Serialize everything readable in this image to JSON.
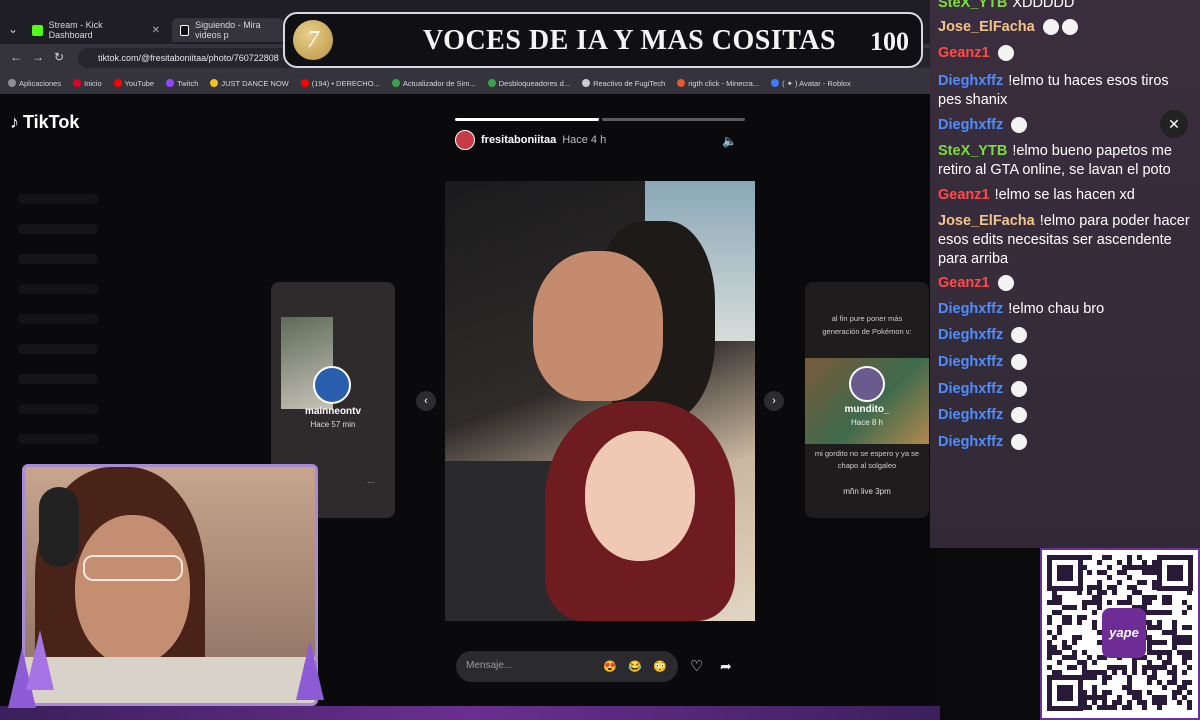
{
  "browser": {
    "tabs": [
      {
        "label": "Stream - Kick Dashboard",
        "icon": "kick-icon",
        "color": "#53fc18"
      },
      {
        "label": "Siguiendo - Mira videos p",
        "icon": "tiktok-icon",
        "color": "#ffffff"
      }
    ],
    "url": "tiktok.com/@fresitaboniitaa/photo/760722808",
    "bookmarks": [
      {
        "label": "Aplicaciones",
        "color": "#8f8f96"
      },
      {
        "label": "Inicio",
        "color": "#e60023"
      },
      {
        "label": "YouTube",
        "color": "#ff0000"
      },
      {
        "label": "Twitch",
        "color": "#9146ff"
      },
      {
        "label": "JUST DANCE NOW",
        "color": "#f0c020"
      },
      {
        "label": "(194) • DERECHO...",
        "color": "#ff0000"
      },
      {
        "label": "Actualizador de Sim...",
        "color": "#3ca34a"
      },
      {
        "label": "Desbloqueadores d...",
        "color": "#3ca34a"
      },
      {
        "label": "Reactivo de FugiTech",
        "color": "#cccccc"
      },
      {
        "label": "rigth click - Minecra...",
        "color": "#e05a2b"
      },
      {
        "label": "( ✦ ) Avatar - Roblox",
        "color": "#3d7bff"
      }
    ]
  },
  "overlay": {
    "number": "7",
    "title": "VOCES DE IA Y MAS COSITAS",
    "count": "100"
  },
  "tiktok": {
    "logo": "TikTok",
    "author": "fresitaboniitaa",
    "time": "Hace 4 h",
    "message_placeholder": "Mensaje...",
    "emojis": [
      "😍",
      "😂",
      "😳"
    ],
    "left_card": {
      "name": "mainneontv",
      "time": "Hace 57 min",
      "more": "..."
    },
    "right_card": {
      "caption_top": "al fin pure poner más generación de Pokémon v:",
      "name": "mundito_",
      "time": "Hace 8 h",
      "caption_bottom": "mi gordito no se espero y ya se chapo al solgaleo",
      "live": "mñn live 3pm"
    }
  },
  "chat": {
    "messages": [
      {
        "user": "SteX_YTB",
        "color": "#7ddc3f",
        "text": "XDDDDD",
        "emotes": 0
      },
      {
        "user": "Jose_ElFacha",
        "color": "#f2c48a",
        "text": "",
        "emotes": 2
      },
      {
        "user": "Geanz1",
        "color": "#ff4a4a",
        "text": "",
        "emotes": 1
      },
      {
        "user": "Dieghxffz",
        "color": "#4f8dff",
        "text": "!elmo tu haces esos tiros pes shanix",
        "emotes": 0
      },
      {
        "user": "Dieghxffz",
        "color": "#4f8dff",
        "text": "",
        "emotes": 1
      },
      {
        "user": "SteX_YTB",
        "color": "#7ddc3f",
        "text": "!elmo bueno papetos me retiro al GTA online, se lavan el poto",
        "emotes": 0
      },
      {
        "user": "Geanz1",
        "color": "#ff4a4a",
        "text": "!elmo se las hacen xd",
        "emotes": 0
      },
      {
        "user": "Jose_ElFacha",
        "color": "#f2c48a",
        "text": "!elmo para poder hacer esos edits necesitas ser ascendente para arriba",
        "emotes": 0
      },
      {
        "user": "Geanz1",
        "color": "#ff4a4a",
        "text": "",
        "emotes": 1
      },
      {
        "user": "Dieghxffz",
        "color": "#4f8dff",
        "text": "!elmo chau bro",
        "emotes": 0
      },
      {
        "user": "Dieghxffz",
        "color": "#4f8dff",
        "text": "",
        "emotes": 1
      },
      {
        "user": "Dieghxffz",
        "color": "#4f8dff",
        "text": "",
        "emotes": 1
      },
      {
        "user": "Dieghxffz",
        "color": "#4f8dff",
        "text": "",
        "emotes": 1
      },
      {
        "user": "Dieghxffz",
        "color": "#4f8dff",
        "text": "",
        "emotes": 1
      },
      {
        "user": "Dieghxffz",
        "color": "#4f8dff",
        "text": "",
        "emotes": 1
      }
    ]
  },
  "qr": {
    "brand": "yape"
  }
}
